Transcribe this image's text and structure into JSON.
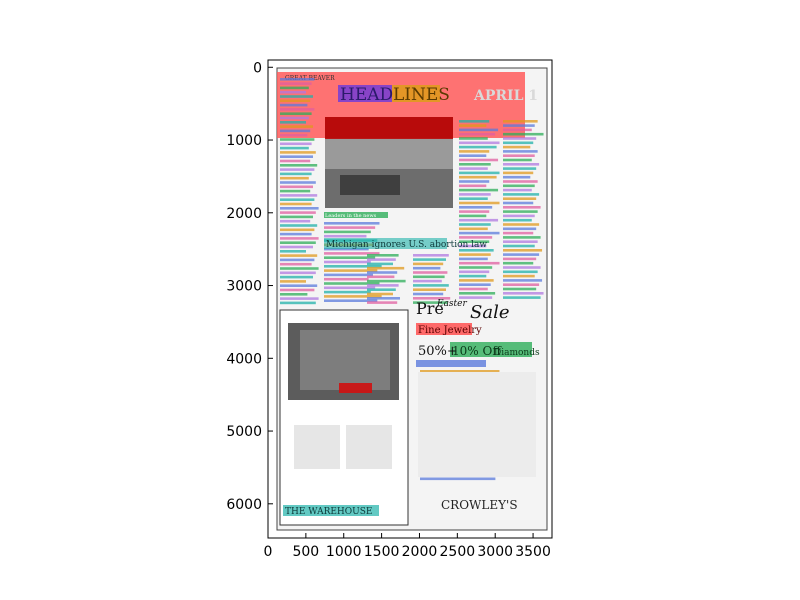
{
  "axes": {
    "x_ticks": [
      0,
      500,
      1000,
      1500,
      2000,
      2500,
      3000,
      3500
    ],
    "y_ticks": [
      0,
      1000,
      2000,
      3000,
      4000,
      5000,
      6000
    ],
    "x_range": [
      0,
      3750
    ],
    "y_range": [
      6470,
      -100
    ],
    "inverted_y": true
  },
  "page": {
    "masthead_left": "GREAT BEAVER",
    "masthead_date": "APRIL 1",
    "headline_word_1": "HEAD",
    "headline_word_2": "LINES",
    "caption_1": "Leaders in the news",
    "article_heading": "Michigan ignores U.S. abortion law",
    "ad_left_title": "THE WAREHOUSE",
    "ad_right_title_1": "Pre",
    "ad_right_title_2": "Easter",
    "ad_right_title_3": "Sale",
    "ad_right_subtitle": "Fine Jewelry",
    "ad_right_offer_1": "50%+",
    "ad_right_offer_2": "10% Off",
    "ad_right_offer_3": "Diamonds",
    "ad_right_brand": "CROWLEY'S"
  },
  "colors": {
    "red_box": "#ff5a5a",
    "dark_red_box": "#b00000",
    "purple_box": "#7b3fd1",
    "orange_box": "#e09a1e",
    "green_box": "#2eae5a",
    "teal_box": "#20b2aa",
    "blue_box": "#5b7bdc",
    "pink_box": "#e05fa0",
    "violet_box": "#b07ae0"
  }
}
